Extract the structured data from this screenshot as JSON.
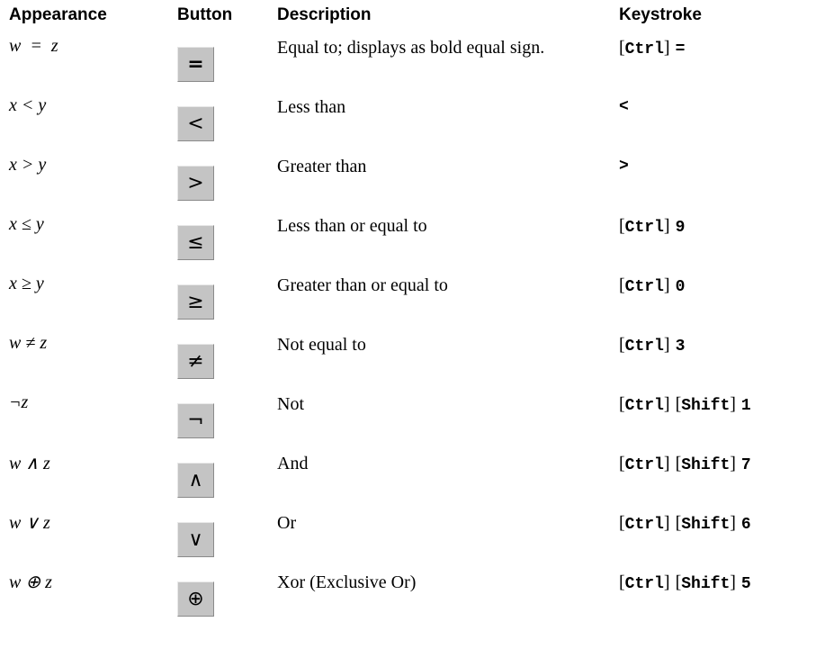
{
  "headers": {
    "appearance": "Appearance",
    "button": "Button",
    "description": "Description",
    "keystroke": "Keystroke"
  },
  "rows": [
    {
      "appearance": "w  =  z",
      "button_symbol": "=",
      "button_icon": "equals-icon",
      "description": "Equal to; displays as bold equal sign.",
      "keys": [
        "Ctrl"
      ],
      "key_suffix": "="
    },
    {
      "appearance": "x < y",
      "button_symbol": "<",
      "button_icon": "less-than-icon",
      "description": "Less than",
      "keys": [],
      "key_suffix": "<"
    },
    {
      "appearance": "x > y",
      "button_symbol": ">",
      "button_icon": "greater-than-icon",
      "description": "Greater than",
      "keys": [],
      "key_suffix": ">"
    },
    {
      "appearance": "x ≤ y",
      "button_symbol": "≤",
      "button_icon": "less-equal-icon",
      "description": "Less than or equal to",
      "keys": [
        "Ctrl"
      ],
      "key_suffix": "9"
    },
    {
      "appearance": "x ≥ y",
      "button_symbol": "≥",
      "button_icon": "greater-equal-icon",
      "description": "Greater than or equal to",
      "keys": [
        "Ctrl"
      ],
      "key_suffix": "0"
    },
    {
      "appearance": "w ≠ z",
      "button_symbol": "≠",
      "button_icon": "not-equal-icon",
      "description": "Not equal to",
      "keys": [
        "Ctrl"
      ],
      "key_suffix": "3"
    },
    {
      "appearance": "¬z",
      "button_symbol": "¬",
      "button_icon": "not-icon",
      "description": "Not",
      "keys": [
        "Ctrl",
        "Shift"
      ],
      "key_suffix": "1"
    },
    {
      "appearance": "w ∧ z",
      "button_symbol": "∧",
      "button_icon": "and-icon",
      "description": "And",
      "keys": [
        "Ctrl",
        "Shift"
      ],
      "key_suffix": "7"
    },
    {
      "appearance": "w ∨ z",
      "button_symbol": "∨",
      "button_icon": "or-icon",
      "description": "Or",
      "keys": [
        "Ctrl",
        "Shift"
      ],
      "key_suffix": "6"
    },
    {
      "appearance": "w ⊕ z",
      "button_symbol": "⊕",
      "button_icon": "xor-icon",
      "description": "Xor (Exclusive Or)",
      "keys": [
        "Ctrl",
        "Shift"
      ],
      "key_suffix": "5"
    }
  ]
}
